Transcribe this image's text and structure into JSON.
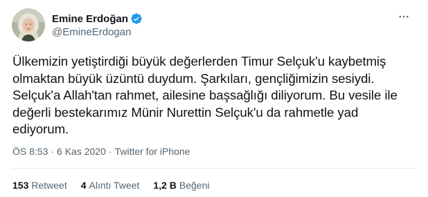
{
  "author": {
    "display_name": "Emine Erdoğan",
    "handle": "@EmineErdogan",
    "verified": true
  },
  "tweet": {
    "lines": [
      "Ülkemizin yetiştirdiği büyük değerlerden Timur Selçuk'u kaybetmiş",
      "olmaktan büyük üzüntü duydum. Şarkıları, gençliğimizin sesiydi.",
      "Selçuk'a Allah'tan rahmet, ailesine başsağlığı diliyorum. Bu vesile ile",
      "değerli bestekarımız Münir Nurettin Selçuk'u da rahmetle yad",
      "ediyorum."
    ],
    "time": "ÖS 8:53",
    "date": "6 Kas 2020",
    "separator": "·",
    "source": "Twitter for iPhone"
  },
  "stats": {
    "retweets": {
      "count": "153",
      "label": "Retweet"
    },
    "quotes": {
      "count": "4",
      "label": "Alıntı Tweet"
    },
    "likes": {
      "count": "1,2 B",
      "label": "Beğeni"
    }
  },
  "icons": {
    "verified": "verified-badge-icon",
    "more": "more-options-icon"
  },
  "colors": {
    "verified_blue": "#1d9bf0",
    "text": "#0f1419",
    "secondary": "#536471",
    "divider": "#e6ecf0"
  }
}
